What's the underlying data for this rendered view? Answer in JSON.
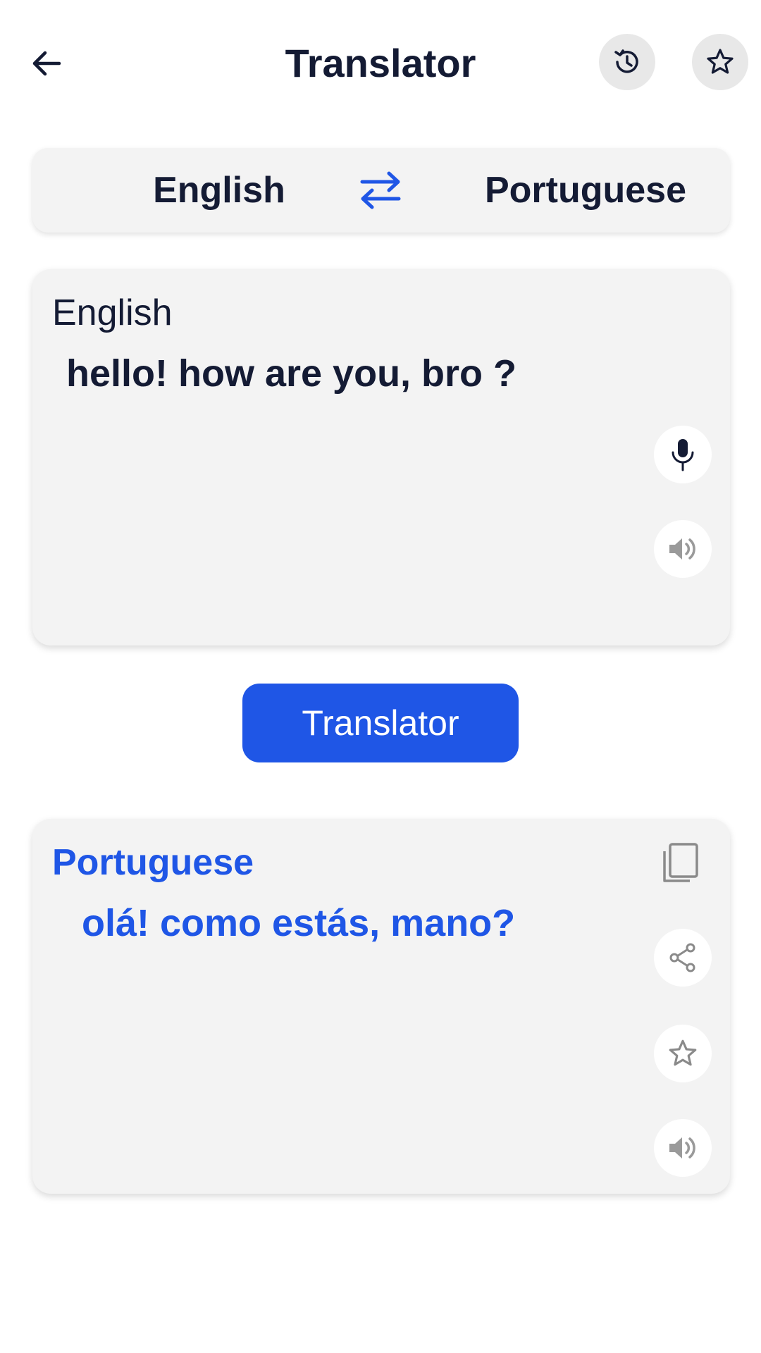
{
  "header": {
    "title": "Translator",
    "back_icon": "arrow-left-icon",
    "history_icon": "history-icon",
    "favorites_icon": "star-icon"
  },
  "language_bar": {
    "source": "English",
    "target": "Portuguese",
    "swap_icon": "swap-arrows-icon",
    "accent_color": "#1f56e6"
  },
  "input": {
    "language_label": "English",
    "text": "hello! how are you, bro ?",
    "mic_icon": "microphone-icon",
    "speaker_icon": "speaker-icon"
  },
  "action": {
    "translate_label": "Translator",
    "color": "#1f56e6"
  },
  "output": {
    "language_label": "Portuguese",
    "text": "olá! como estás, mano?",
    "copy_icon": "copy-icon",
    "share_icon": "share-icon",
    "star_icon": "star-outline-icon",
    "speaker_icon": "speaker-icon",
    "text_color": "#1f56e6"
  }
}
